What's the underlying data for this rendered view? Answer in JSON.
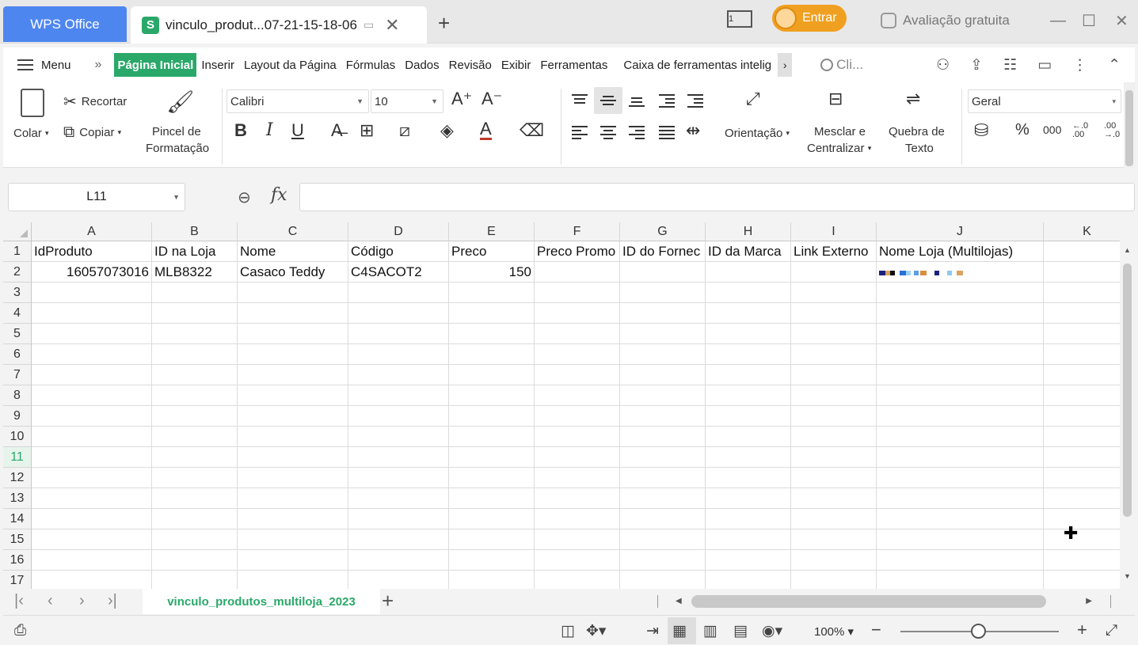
{
  "titlebar": {
    "app_tab": "WPS Office",
    "doc_tab": "vinculo_produt...07-21-15-18-06",
    "login_label": "Entrar",
    "trial_label": "Avaliação gratuita"
  },
  "menu": {
    "menu_label": "Menu",
    "tabs": [
      "Página Inicial",
      "Inserir",
      "Layout da Página",
      "Fórmulas",
      "Dados",
      "Revisão",
      "Exibir",
      "Ferramentas",
      "Caixa de ferramentas intelig"
    ],
    "search_placeholder": "Cli..."
  },
  "ribbon": {
    "paste": "Colar",
    "cut": "Recortar",
    "copy": "Copiar",
    "format_painter_1": "Pincel de",
    "format_painter_2": "Formatação",
    "font_name": "Calibri",
    "font_size": "10",
    "orientation": "Orientação",
    "merge_1": "Mesclar e",
    "merge_2": "Centralizar",
    "wrap_1": "Quebra de",
    "wrap_2": "Texto",
    "number_format": "Geral",
    "percent": "%",
    "thousands": "000"
  },
  "formula_bar": {
    "name_box": "L11",
    "fx": "fx",
    "formula": ""
  },
  "sheet": {
    "columns": [
      "A",
      "B",
      "C",
      "D",
      "E",
      "F",
      "G",
      "H",
      "I",
      "J",
      "K"
    ],
    "rows": [
      "1",
      "2",
      "3",
      "4",
      "5",
      "6",
      "7",
      "8",
      "9",
      "10",
      "11",
      "12",
      "13",
      "14",
      "15",
      "16",
      "17"
    ],
    "selected_row": "11",
    "headers": [
      "IdProduto",
      "ID na Loja",
      "Nome",
      "Código",
      "Preco",
      "Preco Promo",
      "ID do Fornec",
      "ID da Marca",
      "Link Externo",
      "Nome Loja (Multilojas)"
    ],
    "row2": [
      "16057073016",
      "MLB8322",
      "Casaco Teddy",
      "C4SACOT2",
      "150"
    ]
  },
  "sheet_tabs": {
    "active": "vinculo_produtos_multiloja_2023",
    "add": "+"
  },
  "status": {
    "zoom": "100%"
  },
  "colors": {
    "accent": "#2aa86a",
    "wps_blue": "#4e86f0",
    "login_orange": "#f0a020"
  }
}
